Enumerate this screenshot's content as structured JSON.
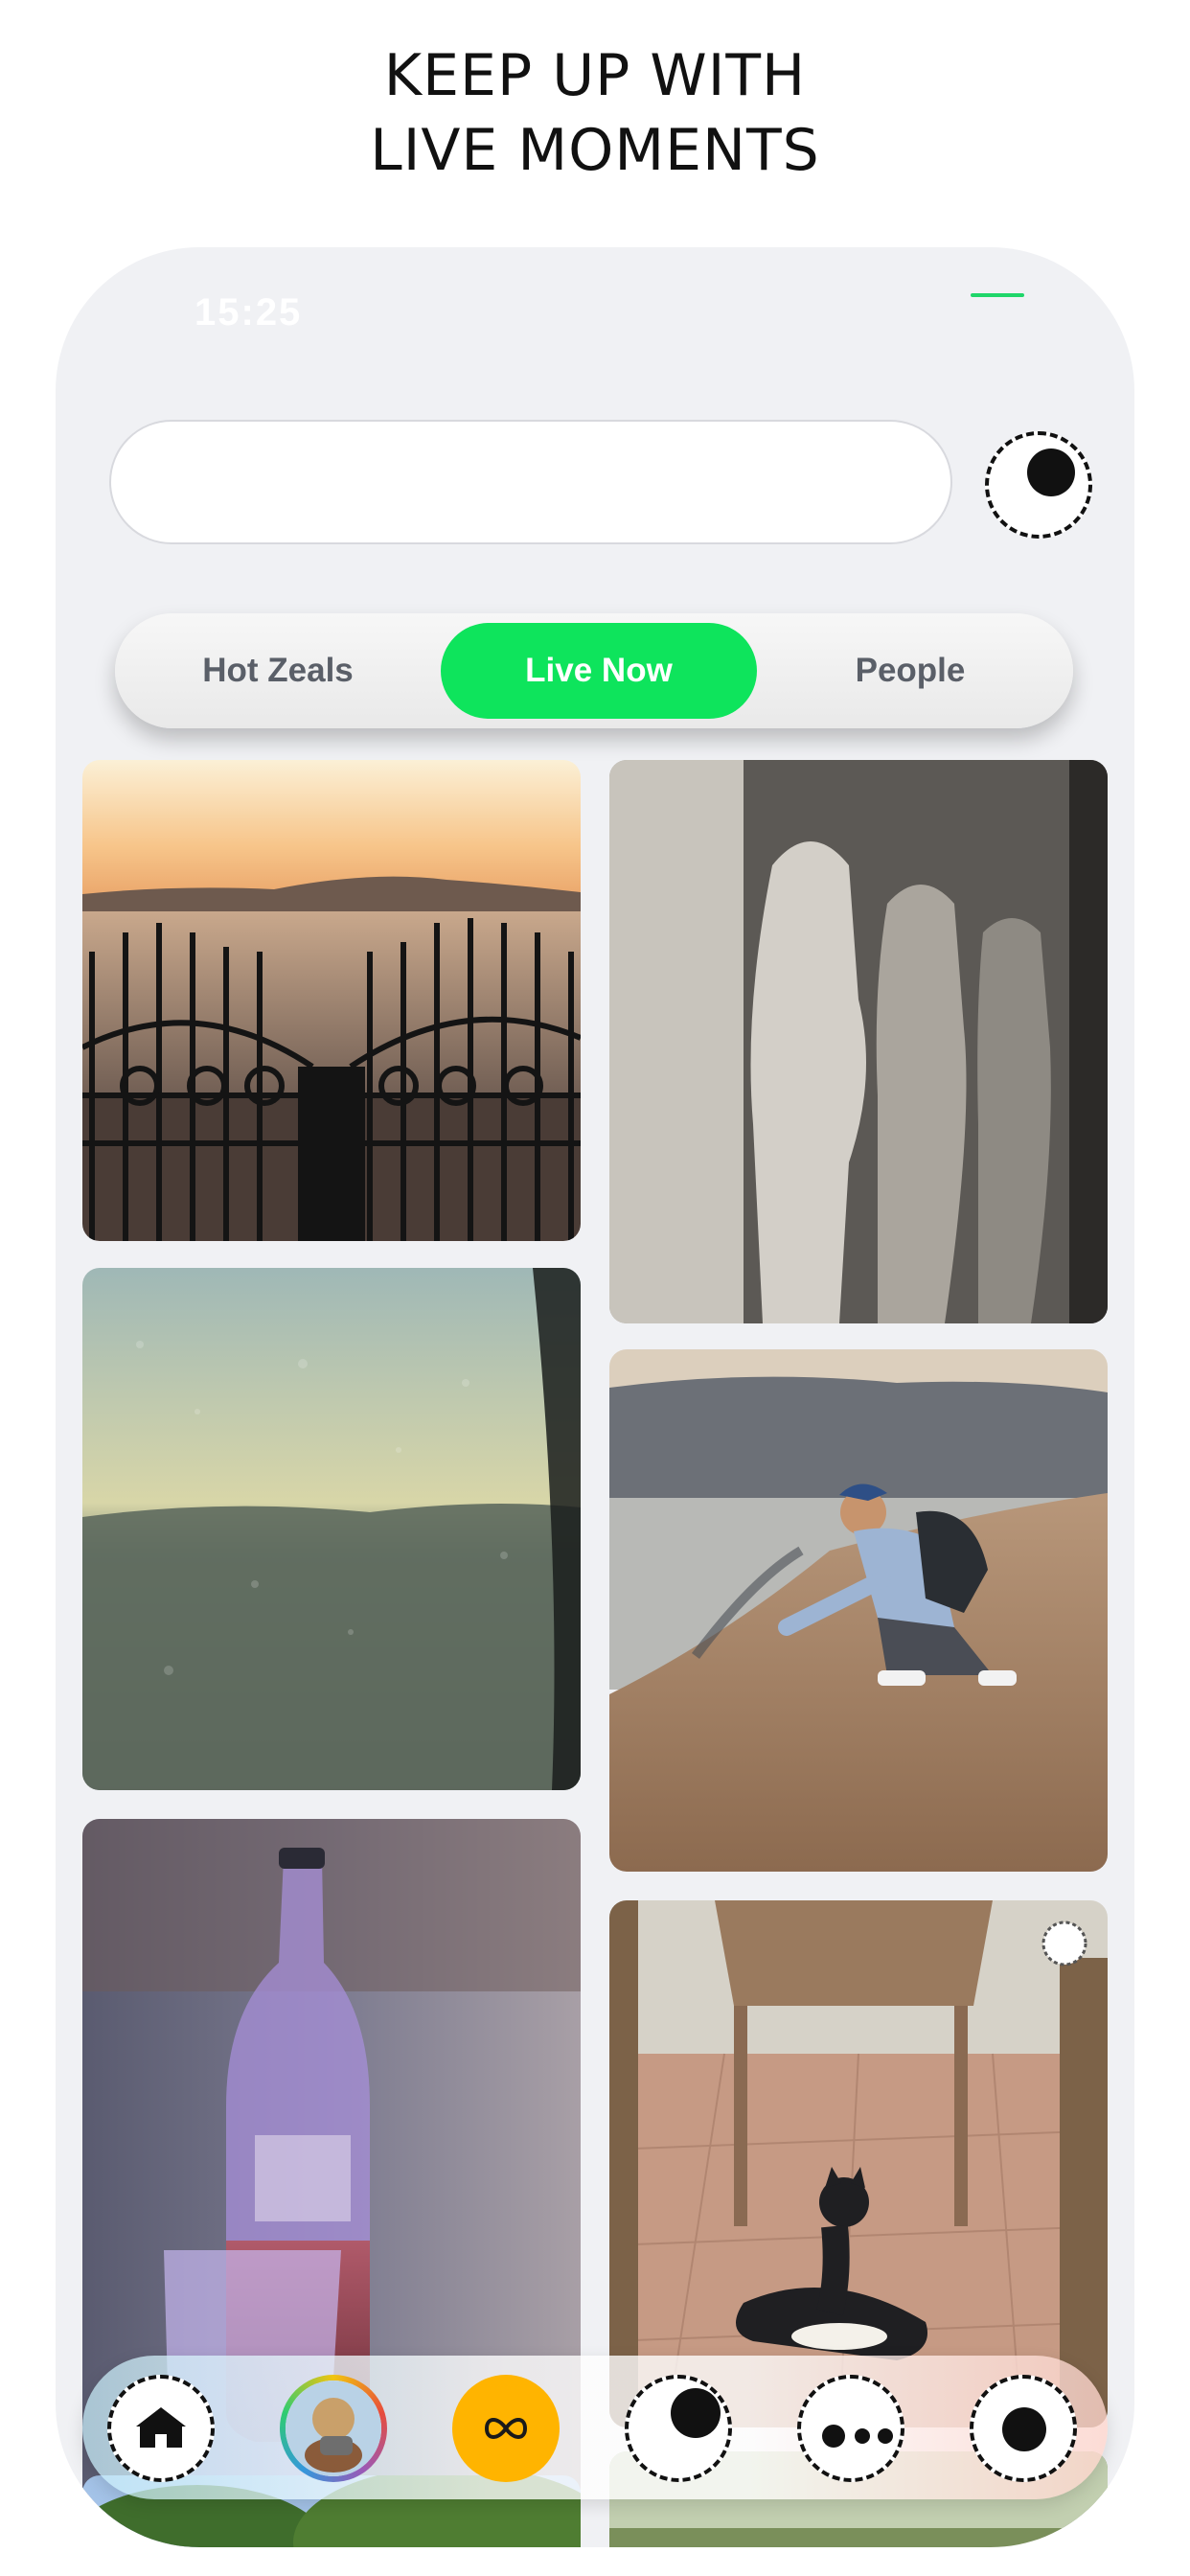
{
  "headline": {
    "line1": "KEEP UP WITH",
    "line2": "LIVE MOMENTS"
  },
  "status_bar": {
    "time": "15:25"
  },
  "search": {
    "value": "",
    "placeholder": ""
  },
  "tabs": [
    {
      "label": "Hot Zeals",
      "active": false
    },
    {
      "label": "Live Now",
      "active": true
    },
    {
      "label": "People",
      "active": false
    }
  ],
  "feed": {
    "left_column": [
      "sunset-gate-photo",
      "rainy-window-photo",
      "whiskey-bottle-photo",
      "tree-photo"
    ],
    "right_column": [
      "statue-relief-photo",
      "beach-man-photo",
      "cat-patio-photo",
      "garden-photo"
    ]
  },
  "bottom_nav": {
    "items": [
      "home-icon",
      "avatar",
      "infinity-icon",
      "record-icon",
      "more-icon",
      "camera-icon"
    ]
  },
  "colors": {
    "accent": "#0ee45c",
    "loop_button": "#ffb400",
    "background": "#f0f1f4"
  }
}
